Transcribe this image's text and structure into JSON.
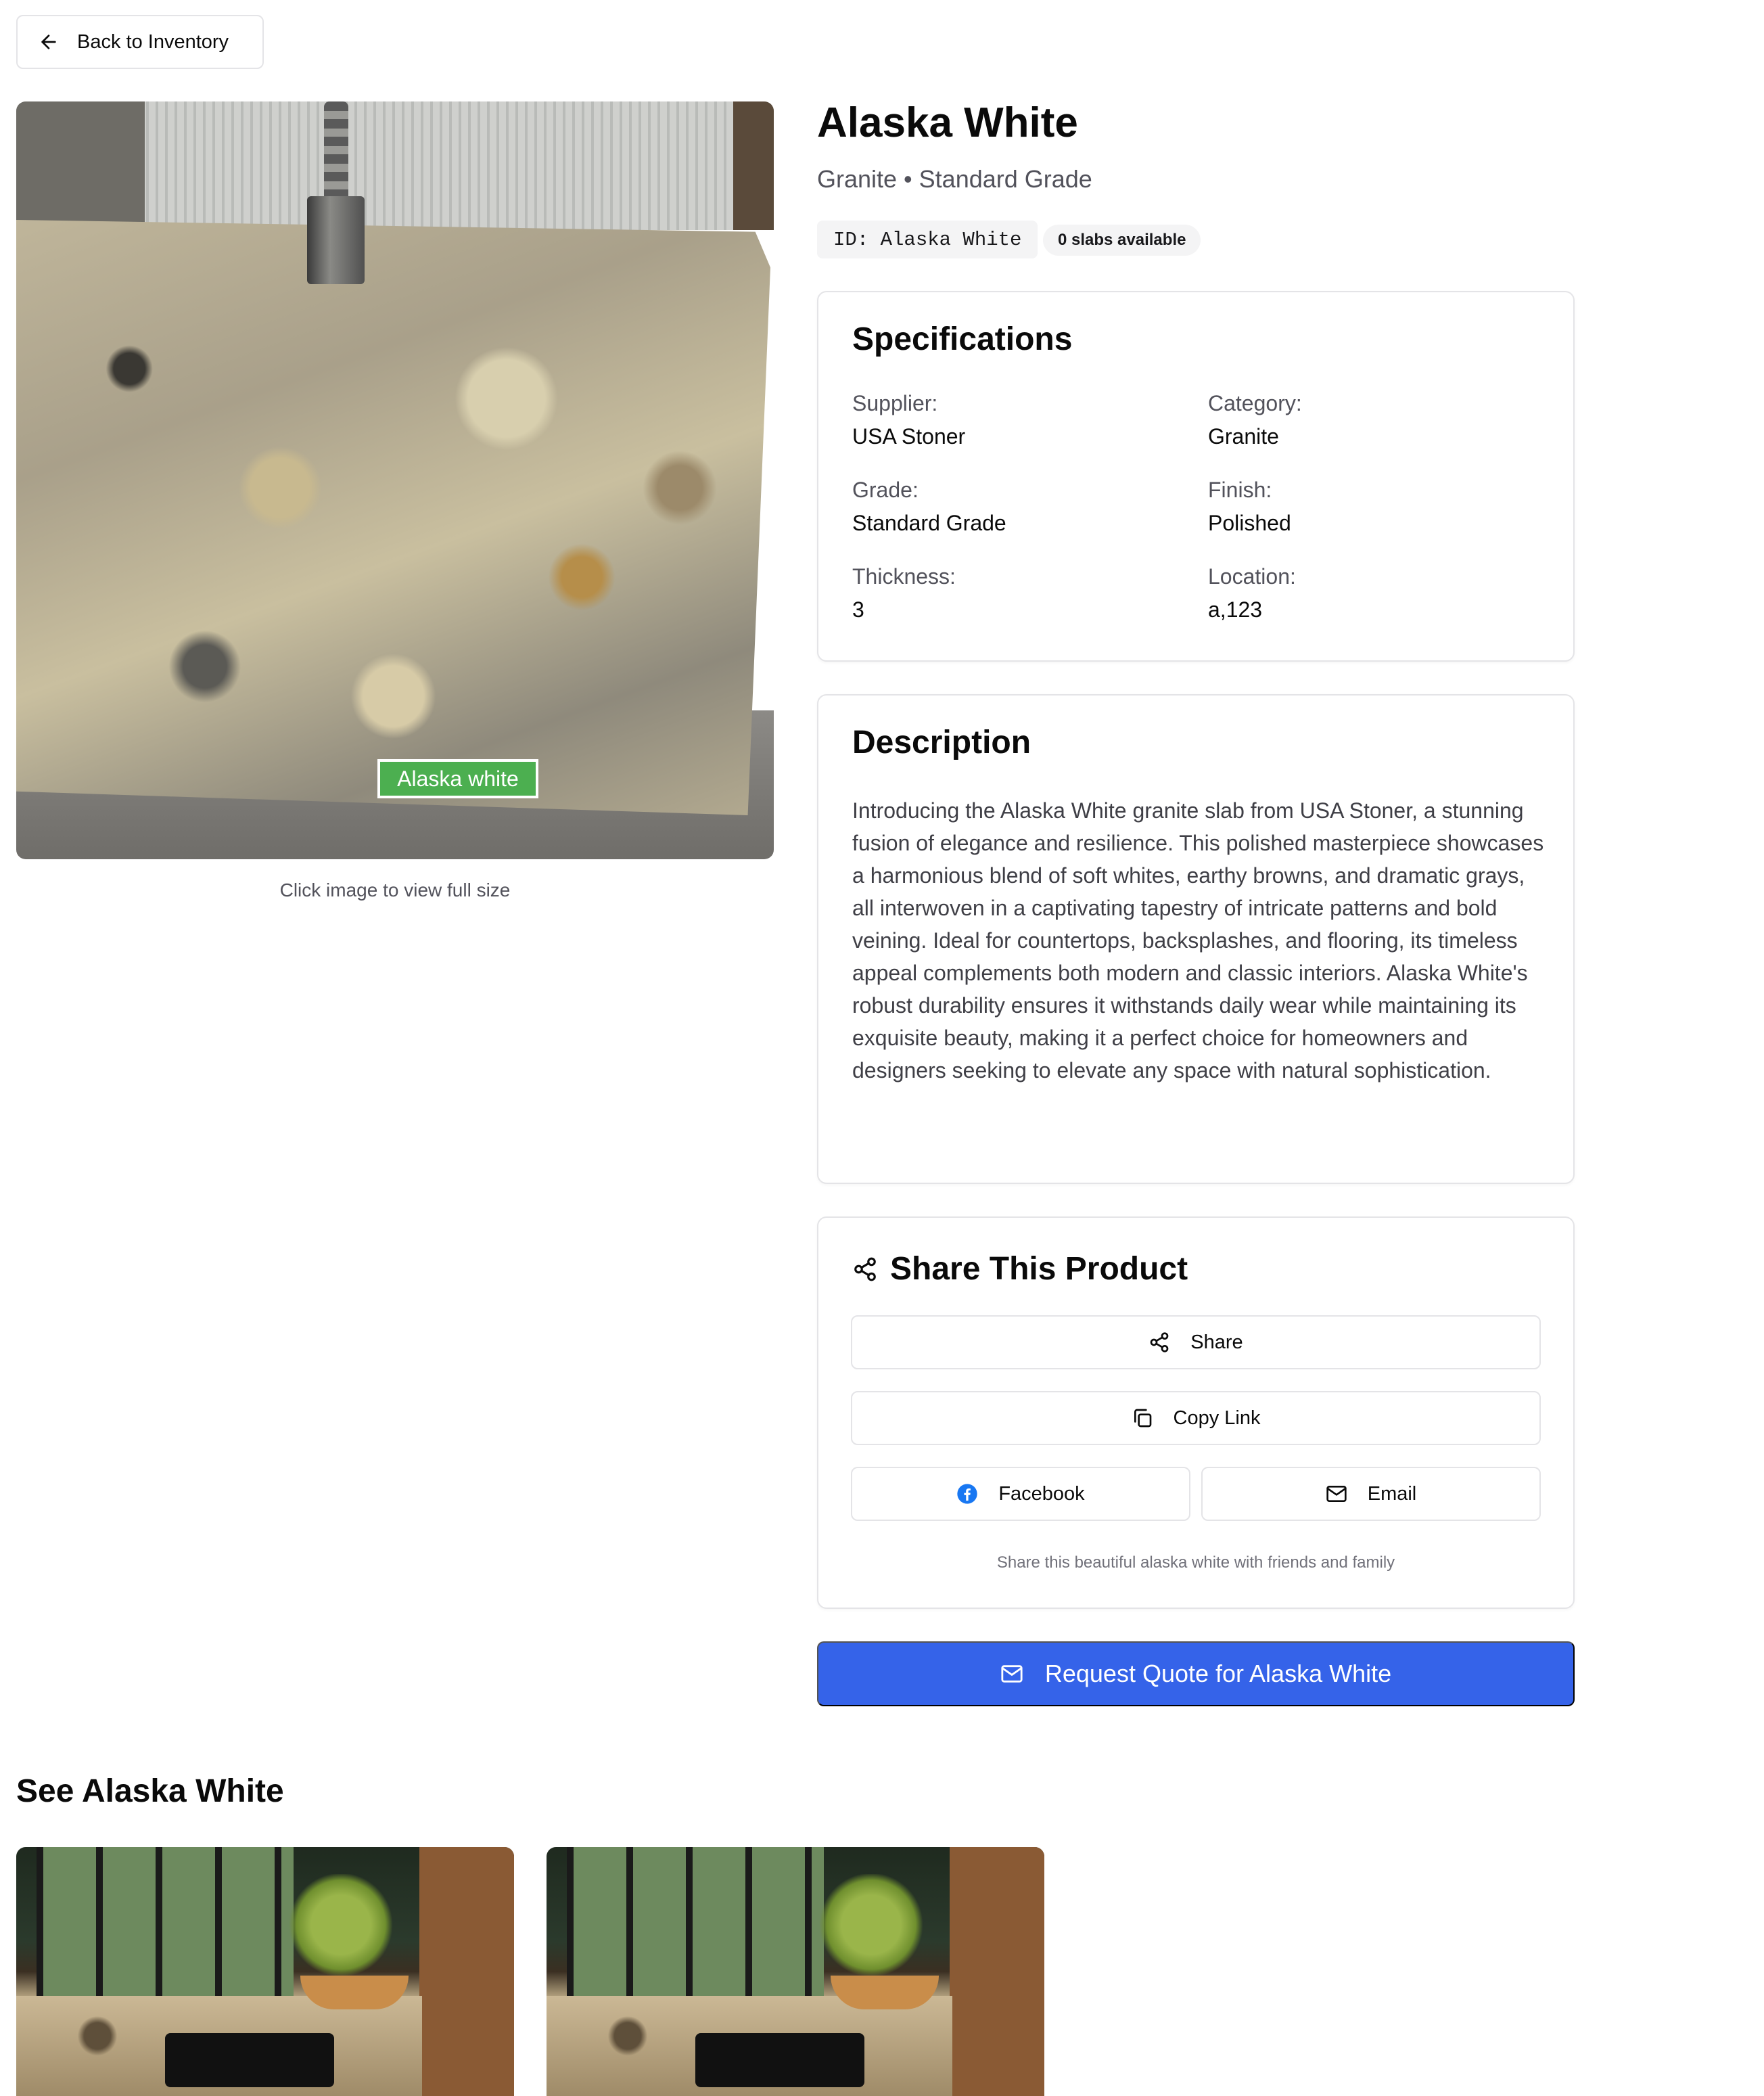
{
  "nav": {
    "back_label": "Back to Inventory"
  },
  "hero": {
    "image_label": "Alaska white",
    "caption": "Click image to view full size"
  },
  "product": {
    "title": "Alaska White",
    "subtitle": "Granite • Standard Grade",
    "id_tag": "ID: Alaska White",
    "availability": "0 slabs available"
  },
  "specs": {
    "heading": "Specifications",
    "items": [
      {
        "label": "Supplier:",
        "value": "USA Stoner"
      },
      {
        "label": "Category:",
        "value": "Granite"
      },
      {
        "label": "Grade:",
        "value": "Standard Grade"
      },
      {
        "label": "Finish:",
        "value": "Polished"
      },
      {
        "label": "Thickness:",
        "value": "3"
      },
      {
        "label": "Location:",
        "value": "a,123"
      }
    ]
  },
  "description": {
    "heading": "Description",
    "text": "Introducing the Alaska White granite slab from USA Stoner, a stunning fusion of elegance and resilience. This polished masterpiece showcases a harmonious blend of soft whites, earthy browns, and dramatic grays, all interwoven in a captivating tapestry of intricate patterns and bold veining. Ideal for countertops, backsplashes, and flooring, its timeless appeal complements both modern and classic interiors. Alaska White's robust durability ensures it withstands daily wear while maintaining its exquisite beauty, making it a perfect choice for homeowners and designers seeking to elevate any space with natural sophistication."
  },
  "share": {
    "heading": "Share This Product",
    "share_label": "Share",
    "copy_label": "Copy Link",
    "facebook_label": "Facebook",
    "email_label": "Email",
    "note": "Share this beautiful alaska white with friends and family",
    "facebook_color": "#1877f2"
  },
  "quote": {
    "label": "Request Quote for Alaska White",
    "color": "#3563e9"
  },
  "gallery": {
    "heading": "See Alaska White"
  }
}
